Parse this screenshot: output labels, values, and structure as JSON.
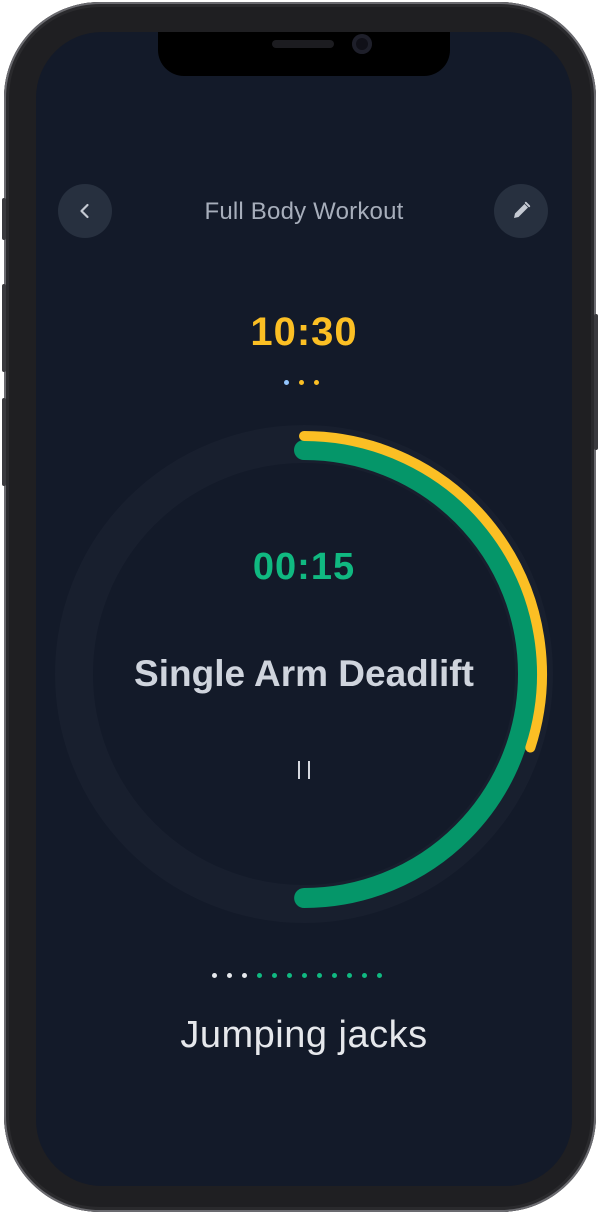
{
  "header": {
    "title": "Full Body Workout",
    "back_icon": "chevron-left-icon",
    "edit_icon": "pencil-icon"
  },
  "workout": {
    "total_time": "10:30",
    "current_exercise": {
      "time_remaining": "00:15",
      "name": "Single Arm Deadlift",
      "exercise_progress": 0.5,
      "workout_progress": 0.3
    },
    "next_exercise": "Jumping jacks",
    "pause_icon": "pause-icon"
  },
  "top_dots": {
    "colors": [
      "#93c5fd",
      "#fbbf24",
      "#fbbf24"
    ]
  },
  "bottom_dots": {
    "completed": 3,
    "total": 12
  },
  "colors": {
    "background": "#131a29",
    "accent_yellow": "#fbbf24",
    "accent_green": "#10b981",
    "green_ring": "#059669",
    "track": "#181f2e"
  }
}
